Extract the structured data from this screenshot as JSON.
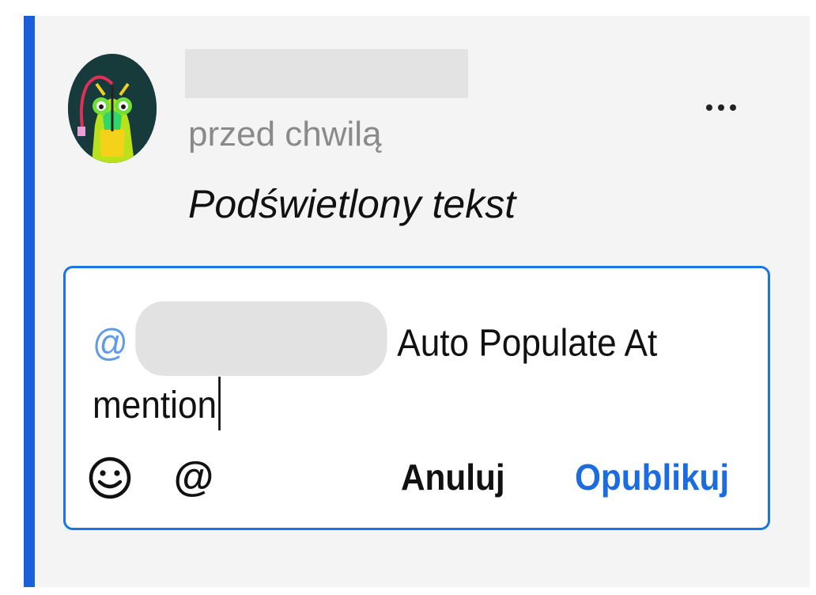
{
  "comment": {
    "author_name": "",
    "timestamp": "przed chwilą",
    "highlighted_text": "Podświetlony tekst",
    "more_icon": "more-horizontal-icon"
  },
  "reply": {
    "at_sign": "@",
    "mentioned_user": "",
    "text_line1_rest": "Auto Populate At",
    "text_line2": "mention"
  },
  "toolbar": {
    "emoji_icon": "smiley-icon",
    "mention_label": "@",
    "cancel_label": "Anuluj",
    "publish_label": "Opublikuj"
  },
  "colors": {
    "accent_bar": "#1a5fd8",
    "reply_border": "#1a73e8",
    "publish": "#1a6ce0",
    "mention_at": "#5f9be8",
    "card_background": "#f4f4f4"
  }
}
